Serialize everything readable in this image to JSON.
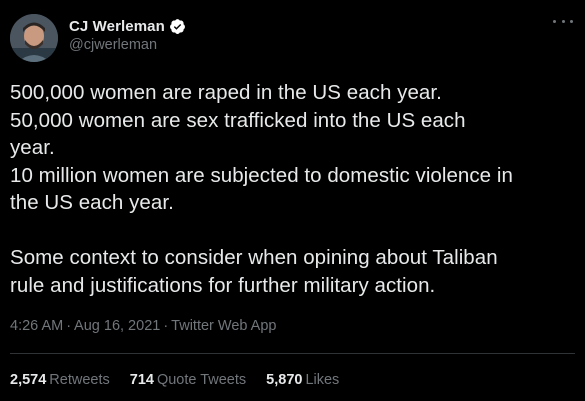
{
  "author": {
    "display_name": "CJ Werleman",
    "handle": "@cjwerleman",
    "verified": true
  },
  "tweet": {
    "lines": [
      "500,000 women are raped in the US each year.",
      "50,000 women are sex trafficked into the US each",
      "year.",
      "10 million women are subjected to domestic violence in",
      "the US each year.",
      "",
      "Some context to consider when opining about Taliban",
      "rule and justifications for further military action."
    ],
    "time": "4:26 AM",
    "date": "Aug 16, 2021",
    "source": "Twitter Web App",
    "separator": "·"
  },
  "stats": {
    "retweets_count": "2,574",
    "retweets_label": "Retweets",
    "quotes_count": "714",
    "quotes_label": "Quote Tweets",
    "likes_count": "5,870",
    "likes_label": "Likes"
  },
  "colors": {
    "background": "#000000",
    "primary_text": "#e7e9ea",
    "secondary_text": "#71767b",
    "verified_badge": "#ffffff",
    "divider": "#2f3336"
  },
  "icons": {
    "verified": "verified-badge-icon",
    "more": "more-horizontal-icon"
  }
}
